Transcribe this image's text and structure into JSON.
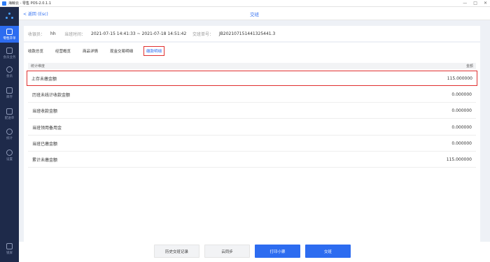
{
  "window": {
    "title": "海鲸云 - 零售 POS-2.0.1.1"
  },
  "sidebar": {
    "items": [
      {
        "label": "零售开单",
        "icon": "cart-icon",
        "active": true
      },
      {
        "label": "会员业务",
        "icon": "member-icon"
      },
      {
        "label": "会员",
        "icon": "user-icon"
      },
      {
        "label": "库存",
        "icon": "inventory-icon"
      },
      {
        "label": "配送单",
        "icon": "delivery-icon"
      },
      {
        "label": "统计",
        "icon": "chart-icon"
      },
      {
        "label": "设置",
        "icon": "gear-icon"
      },
      {
        "label": "锁屏",
        "icon": "lock-icon"
      }
    ]
  },
  "header": {
    "back_label": "< 返回 (Esc)",
    "title": "交班"
  },
  "info": {
    "cashier_label": "收银员：",
    "cashier_value": "hh",
    "time_label": "当班时间：",
    "time_value": "2021-07-15 14:41:33 ~ 2021-07-18 14:51:42",
    "shift_no_label": "交班单号：",
    "shift_no_value": "JB202107151441325441.3"
  },
  "tabs": [
    {
      "label": "收款总览"
    },
    {
      "label": "经营概览"
    },
    {
      "label": "商品详情"
    },
    {
      "label": "现金交易明细"
    },
    {
      "label": "缴款明细",
      "active": true
    }
  ],
  "table": {
    "col_left": "统计维度",
    "col_right": "金额",
    "rows": [
      {
        "label": "上存未缴金额",
        "value": "115.000000"
      },
      {
        "label": "历班未线计收款金额",
        "value": "0.000000"
      },
      {
        "label": "当班收款金额",
        "value": "0.000000"
      },
      {
        "label": "当班领用备用金",
        "value": "0.000000"
      },
      {
        "label": "当班已缴金额",
        "value": "0.000000"
      },
      {
        "label": "累计未缴金额",
        "value": "115.000000"
      }
    ]
  },
  "footer": {
    "history_label": "历史交班记录",
    "sync_label": "云同步",
    "print_label": "打印小票",
    "handover_label": "交班"
  },
  "colors": {
    "accent": "#2d6cf0",
    "sidebar_bg": "#1e2a4a",
    "highlight_border": "#e03030"
  }
}
